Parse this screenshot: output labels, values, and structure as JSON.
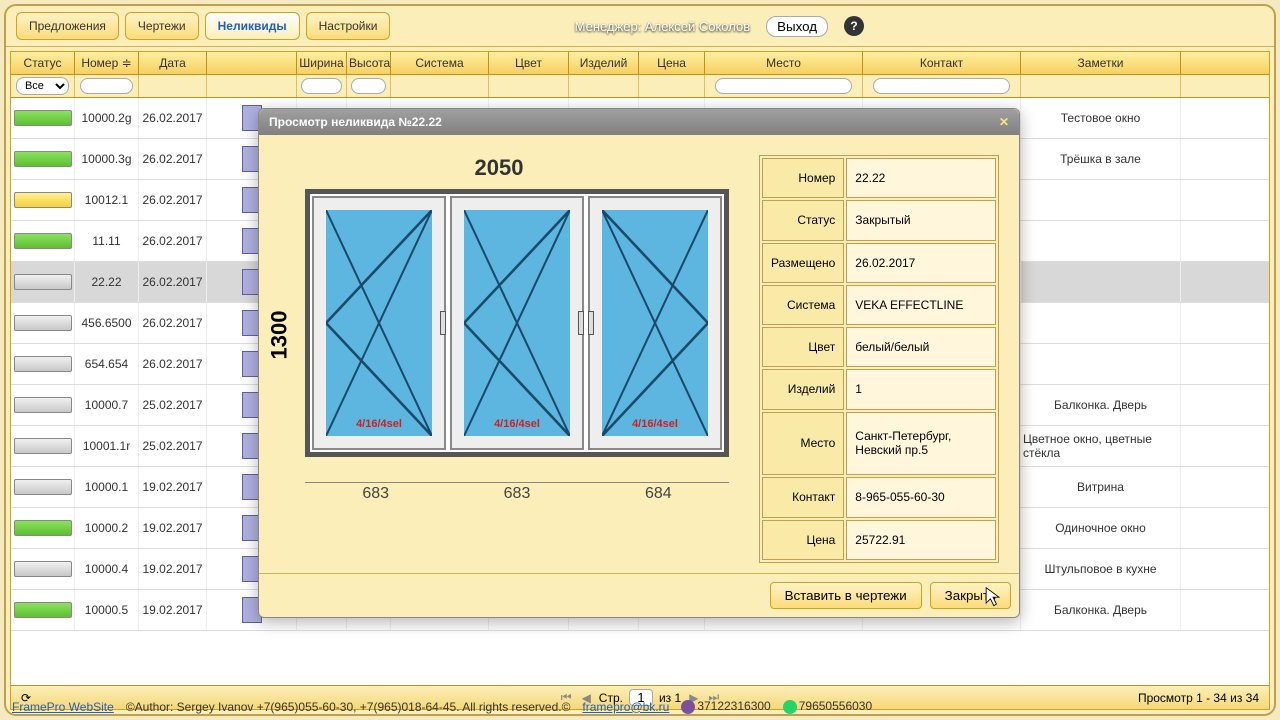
{
  "header": {
    "tabs": [
      "Предложения",
      "Чертежи",
      "Неликвиды",
      "Настройки"
    ],
    "active_tab": 2,
    "manager_label": "Менеджер: Алексей Соколов",
    "logout": "Выход"
  },
  "grid": {
    "columns": [
      "Статус",
      "Номер",
      "Дата",
      "",
      "Ширина",
      "Высота",
      "Система",
      "Цвет",
      "Изделий",
      "Цена",
      "Место",
      "Контакт",
      "Заметки"
    ],
    "status_filter": "Все",
    "rows": [
      {
        "status": "green",
        "num": "10000.2g",
        "date": "26.02.2017",
        "notes": "Тестовое окно"
      },
      {
        "status": "green",
        "num": "10000.3g",
        "date": "26.02.2017",
        "notes": "Трёшка в зале"
      },
      {
        "status": "yellow",
        "num": "10012.1",
        "date": "26.02.2017",
        "notes": ""
      },
      {
        "status": "green",
        "num": "11.11",
        "date": "26.02.2017",
        "notes": ""
      },
      {
        "status": "gray",
        "num": "22.22",
        "date": "26.02.2017",
        "notes": "",
        "selected": true
      },
      {
        "status": "gray",
        "num": "456.6500",
        "date": "26.02.2017",
        "notes": ""
      },
      {
        "status": "gray",
        "num": "654.654",
        "date": "26.02.2017",
        "notes": ""
      },
      {
        "status": "gray",
        "num": "10000.7",
        "date": "25.02.2017",
        "notes": "Балконка. Дверь"
      },
      {
        "status": "gray",
        "num": "10001.1r",
        "date": "25.02.2017",
        "notes": "Цветное окно, цветные стёкла"
      },
      {
        "status": "gray",
        "num": "10000.1",
        "date": "19.02.2017",
        "right": "67",
        "notes": "Витрина"
      },
      {
        "status": "green",
        "num": "10000.2",
        "date": "19.02.2017",
        "right": "67",
        "notes": "Одиночное окно"
      },
      {
        "status": "gray",
        "num": "10000.4",
        "date": "19.02.2017",
        "right": "67",
        "notes": "Штульповое в кухне"
      },
      {
        "status": "green",
        "num": "10000.5",
        "date": "19.02.2017",
        "right": "67",
        "notes": "Балконка. Дверь"
      }
    ],
    "pager": {
      "label_page": "Стр.",
      "page": "1",
      "of": "из 1",
      "summary": "Просмотр 1 - 34 из 34"
    }
  },
  "modal": {
    "title": "Просмотр неликвида №22.22",
    "top_dim": "2050",
    "left_dim": "1300",
    "glass": "4/16/4sel",
    "bottoms": [
      "683",
      "683",
      "684"
    ],
    "detail_labels": [
      "Номер",
      "Статус",
      "Размещено",
      "Система",
      "Цвет",
      "Изделий",
      "Место",
      "Контакт",
      "Цена"
    ],
    "detail_values": [
      "22.22",
      "Закрытый",
      "26.02.2017",
      "VEKA EFFECTLINE",
      "белый/белый",
      "1",
      "Санкт-Петербург, Невский пр.5",
      "8-965-055-60-30",
      "25722.91"
    ],
    "btn_insert": "Вставить в чертежи",
    "btn_close": "Закрыть"
  },
  "footer": {
    "site": "FramePro WebSite",
    "author": "©Author: Sergey Ivanov +7(965)055-60-30, +7(965)018-64-45. All rights reserved.©",
    "email": "framepro@bk.ru",
    "viber": "37122316300",
    "whatsapp": "79650556030"
  }
}
